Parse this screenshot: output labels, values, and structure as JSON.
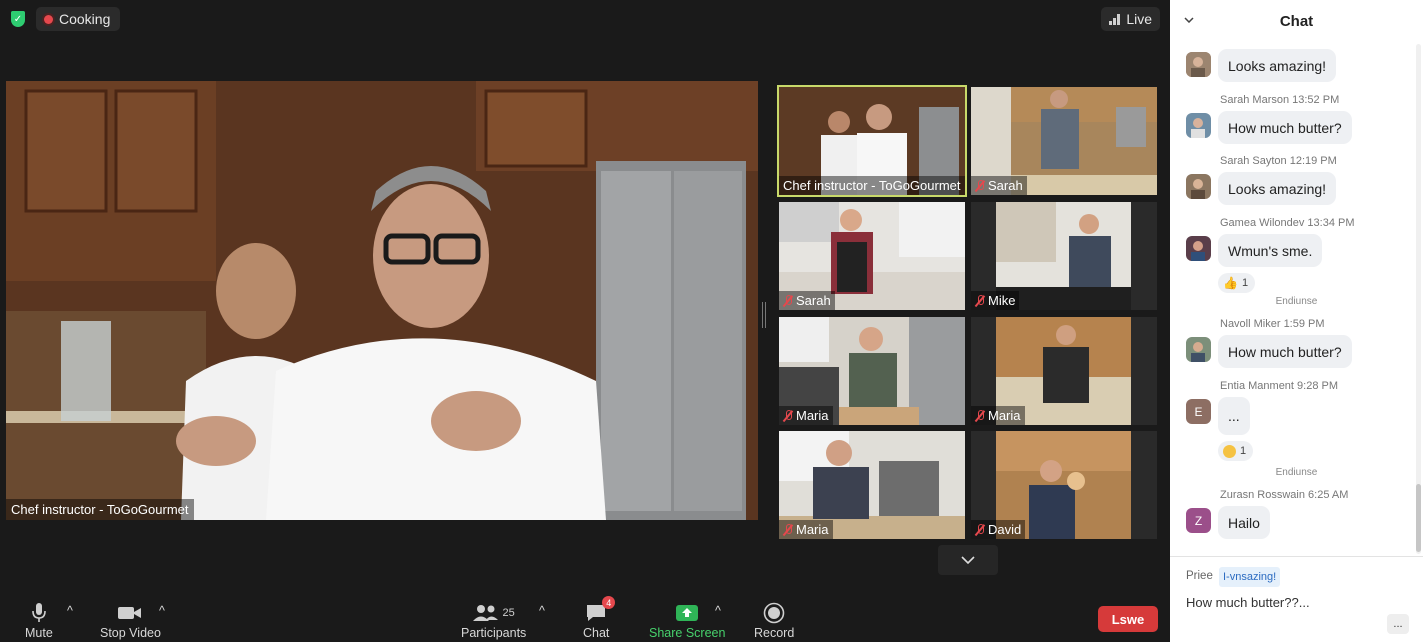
{
  "top_bar": {
    "topic": "Cooking",
    "live_label": "Live"
  },
  "main_video": {
    "name": "Chef instructor - ToGoGourmet"
  },
  "gallery": [
    {
      "name": "Chef instructor - ToGoGourmet",
      "muted": false,
      "active": true
    },
    {
      "name": "Sarah",
      "muted": true
    },
    {
      "name": "Sarah",
      "muted": true
    },
    {
      "name": "Mike",
      "muted": true
    },
    {
      "name": "Maria",
      "muted": true
    },
    {
      "name": "Maria",
      "muted": true
    },
    {
      "name": "Maria",
      "muted": true
    },
    {
      "name": "David",
      "muted": true
    }
  ],
  "toolbar": {
    "mute": "Mute",
    "stop_video": "Stop Video",
    "participants": "Participants",
    "participants_count": "25",
    "chat": "Chat",
    "chat_badge": "4",
    "share_screen": "Share Screen",
    "record": "Record",
    "leave": "Lswe"
  },
  "chat": {
    "title": "Chat",
    "messages": [
      {
        "sender": "",
        "text": "Looks amazing!"
      },
      {
        "sender": "Sarah Marson 13:52 PM",
        "text": "How much butter?"
      },
      {
        "sender": "Sarah Sayton 12:19 PM",
        "text": "Looks amazing!"
      },
      {
        "sender": "Gamea Wilondev 13:34 PM",
        "text": "Wmun's sme.",
        "reaction_count": "1"
      },
      {
        "sender": "Navoll Miker 1:59 PM",
        "text": "How much butter?"
      },
      {
        "sender": "Entia Manment 9:28 PM",
        "text": "...",
        "avatar_letter": "E",
        "reaction_count": "1"
      },
      {
        "sender": "Zurasn Rosswain 6:25 AM",
        "text": "Hailo",
        "avatar_letter": "Z"
      }
    ],
    "system_notes": [
      "Endiunse",
      "Endiunse"
    ],
    "input": {
      "to_label": "Priee",
      "recipient_chip": "I-vnsazing!",
      "draft": "How much butter??..."
    },
    "more": "..."
  },
  "colors": {
    "background": "#1a1a1a",
    "active_speaker_border": "#c8d96a",
    "share_green": "#47d16c",
    "leave_red": "#d63a3a",
    "chat_bubble": "#eef0f3"
  }
}
